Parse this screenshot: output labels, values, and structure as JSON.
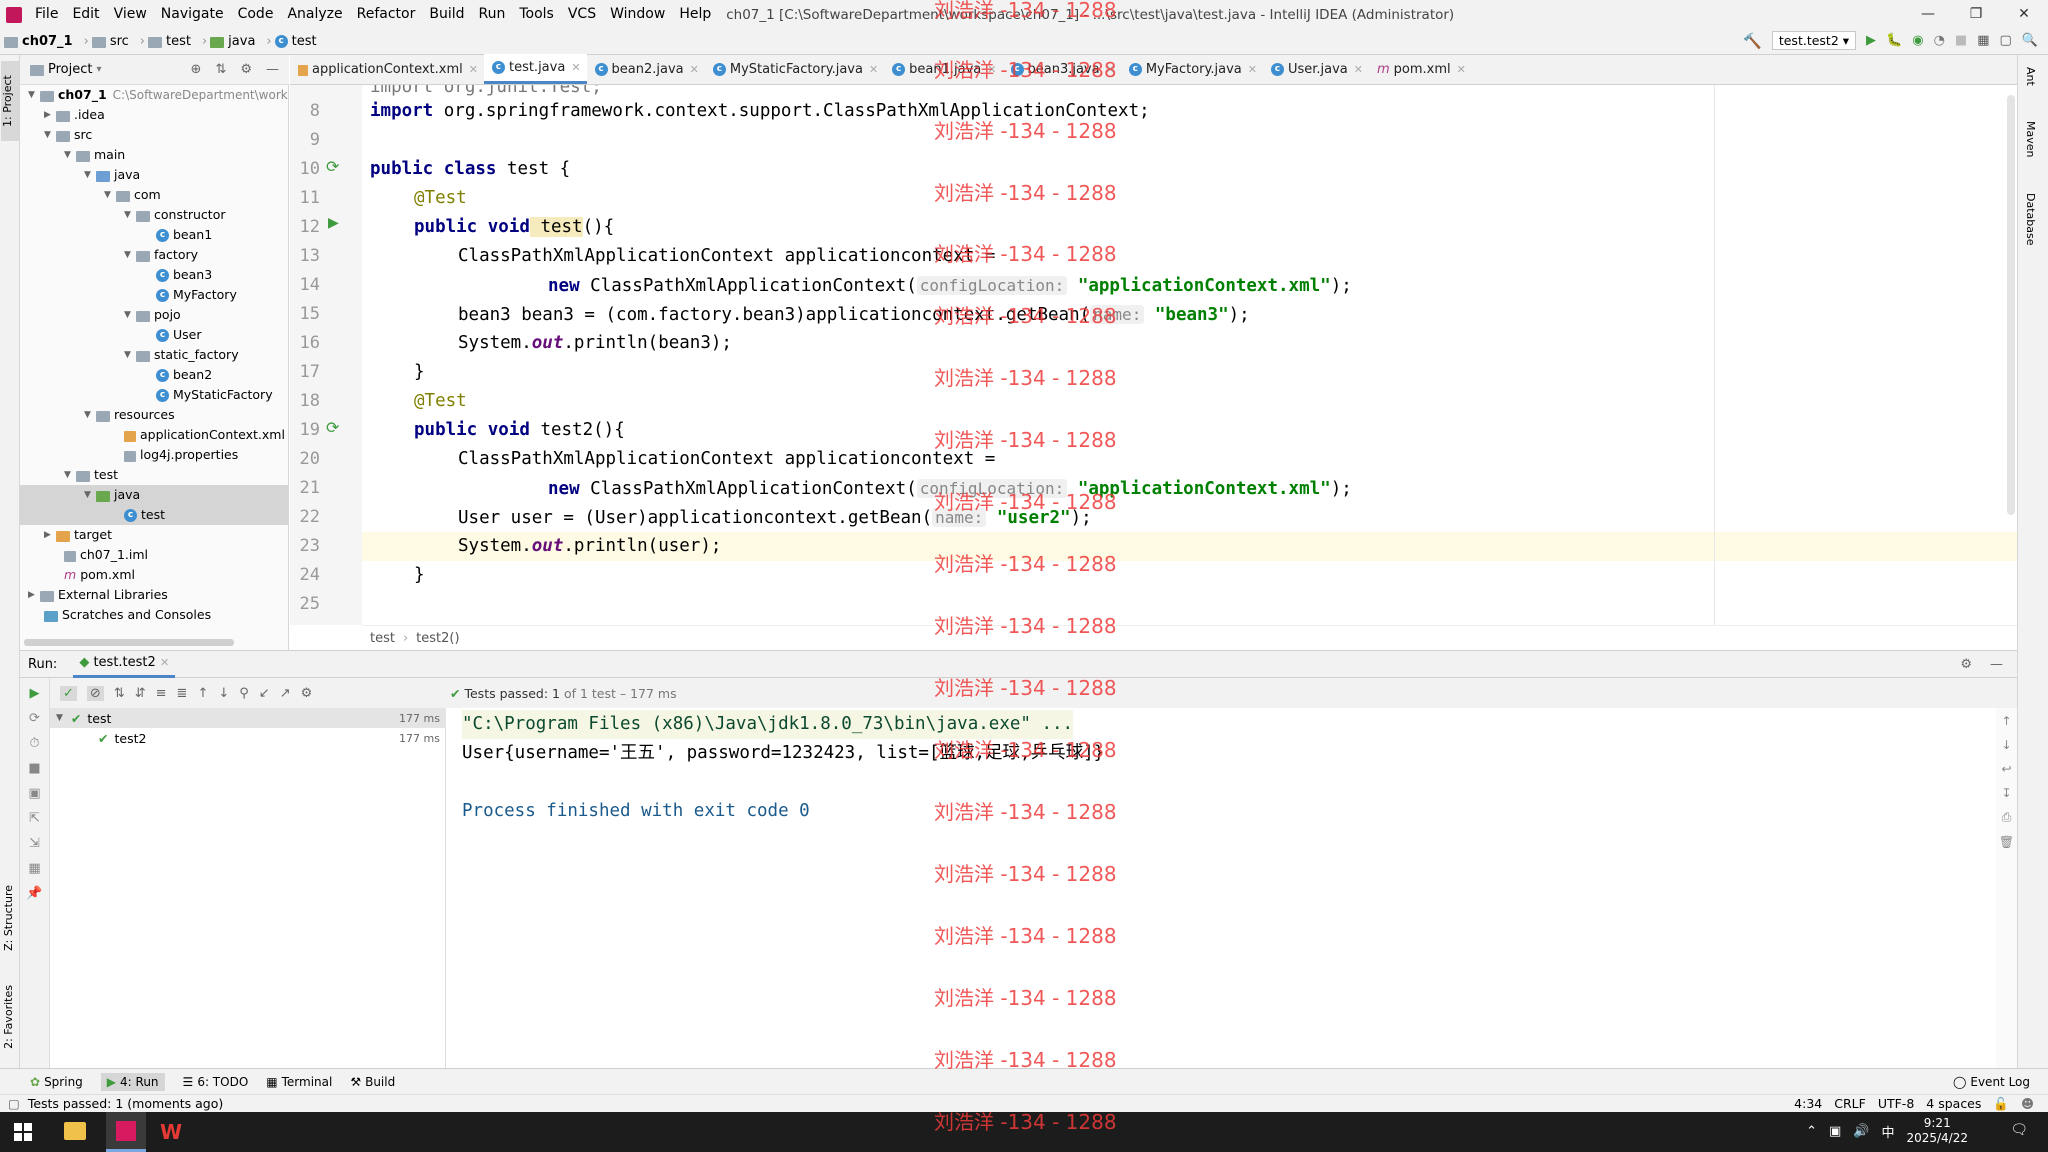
{
  "window": {
    "title": "ch07_1 [C:\\SoftwareDepartment\\workspace\\ch07_1] - ...\\src\\test\\java\\test.java - IntelliJ IDEA (Administrator)",
    "menu": [
      "File",
      "Edit",
      "View",
      "Navigate",
      "Code",
      "Analyze",
      "Refactor",
      "Build",
      "Run",
      "Tools",
      "VCS",
      "Window",
      "Help"
    ]
  },
  "navbar": {
    "crumbs": [
      "ch07_1",
      "src",
      "test",
      "java",
      "test"
    ],
    "run_config": "test.test2"
  },
  "project": {
    "header": "Project",
    "root_label": "ch07_1",
    "root_path": "C:\\SoftwareDepartment\\works",
    "nodes": [
      ".idea",
      "src",
      "main",
      "java",
      "com",
      "constructor",
      "bean1",
      "factory",
      "bean3",
      "MyFactory",
      "pojo",
      "User",
      "static_factory",
      "bean2",
      "MyStaticFactory",
      "resources",
      "applicationContext.xml",
      "log4j.properties",
      "test",
      "java",
      "test",
      "target",
      "ch07_1.iml",
      "pom.xml",
      "External Libraries",
      "Scratches and Consoles"
    ]
  },
  "tabs": [
    "applicationContext.xml",
    "test.java",
    "bean2.java",
    "MyStaticFactory.java",
    "bean1.java",
    "bean3.java",
    "MyFactory.java",
    "User.java",
    "pom.xml"
  ],
  "editor": {
    "line_numbers": [
      "8",
      "9",
      "10",
      "11",
      "12",
      "13",
      "14",
      "15",
      "16",
      "17",
      "18",
      "19",
      "20",
      "21",
      "22",
      "23",
      "24",
      "25"
    ],
    "top_partial": "import org.junit.Test;",
    "l8_kw": "import",
    "l8_rest": " org.springframework.context.support.ClassPathXmlApplicationContext;",
    "l10_kw": "public class",
    "l10_rest": " test {",
    "ann_test": "@Test",
    "kw_public_void": "public void",
    "l12_name": " test",
    "l12_rest": "(){",
    "l13": "ClassPathXmlApplicationContext applicationcontext =",
    "kw_new": "new",
    "new_ctor": " ClassPathXmlApplicationContext(",
    "hint_config": "configLocation:",
    "str_appctx": "\"applicationContext.xml\"",
    "close_paren_semi": ");",
    "l15_pre": "bean3 bean3 = (com.factory.bean3)applicationcontext.getBean(",
    "hint_name": "name:",
    "str_bean3": "\"bean3\"",
    "l16_pre": "System.",
    "fld_out": "out",
    "l16_rest": ".println(bean3);",
    "close_brace": "}",
    "l19_name": " test2",
    "l22_pre": "User user = (User)applicationcontext.getBean(",
    "str_user2": "\"user2\"",
    "l23_rest": ".println(user);",
    "crumbs": [
      "test",
      "test2()"
    ]
  },
  "run": {
    "label": "Run:",
    "tab": "test.test2",
    "passed_bold": "Tests passed: 1",
    "passed_rest": " of 1 test – 177 ms",
    "tree": [
      {
        "label": "test",
        "time": "177 ms"
      },
      {
        "label": "test2",
        "time": "177 ms"
      }
    ],
    "console": [
      "\"C:\\Program Files (x86)\\Java\\jdk1.8.0_73\\bin\\java.exe\" ...",
      "User{username='王五', password=1232423, list=[篮球,足球,乒乓球]}",
      "",
      "Process finished with exit code 0"
    ]
  },
  "toolwindows": [
    "Spring",
    "4: Run",
    "6: TODO",
    "Terminal",
    "Build",
    "Event Log"
  ],
  "status": {
    "message": "Tests passed: 1 (moments ago)",
    "position": "4:34",
    "line_sep": "CRLF",
    "encoding": "UTF-8",
    "indent": "4 spaces"
  },
  "taskbar": {
    "time": "9:21",
    "date": "2025/4/22",
    "ime": "中"
  },
  "watermark": "刘浩洋 -134 - 1288",
  "side_labels": {
    "left_top": "1: Project",
    "left_bottom_1": "Z: Structure",
    "left_bottom_2": "2: Favorites",
    "right": [
      "Ant",
      "Maven",
      "Database"
    ]
  }
}
